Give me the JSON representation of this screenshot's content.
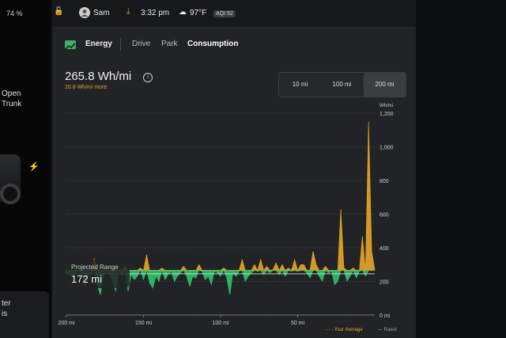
{
  "left_panel": {
    "battery": "74 %",
    "trunk_line1": "Open",
    "trunk_line2": "Trunk",
    "bottom_text": "ter\nis"
  },
  "status_bar": {
    "user": "Sam",
    "time": "3:32 pm",
    "temperature": "97°F",
    "aqi": "AQI 52"
  },
  "tabs": {
    "energy": "Energy",
    "drive": "Drive",
    "park": "Park",
    "consumption": "Consumption"
  },
  "summary": {
    "value": "265.8 Wh/mi",
    "delta": "20.8 Wh/mi more",
    "delta_suffix": "than Rated"
  },
  "range_options": [
    "10 mi",
    "100 mi",
    "200 mi"
  ],
  "selected_range": "200 mi",
  "projected": {
    "label": "Projected Range",
    "value": "172 mi"
  },
  "legend": {
    "average": "Your Average",
    "rated": "Rated"
  },
  "colors": {
    "above": "#e8a528",
    "below": "#2fc36b",
    "accent": "#3fae6a"
  },
  "chart_data": {
    "type": "area",
    "ylabel": "Wh/mi",
    "ylim": [
      0,
      1200
    ],
    "yticks": [
      "1,200",
      "1,000",
      "800",
      "600",
      "400",
      "200",
      "0 mi"
    ],
    "xticks": [
      "200 mi",
      "150 mi",
      "100 mi",
      "50 mi"
    ],
    "x_range": [
      200,
      0
    ],
    "average": 265.8,
    "rated": 245,
    "series": [
      {
        "x": [
          200,
          198,
          196,
          194,
          192,
          190,
          188,
          186,
          184,
          182,
          180,
          178,
          176,
          174,
          172,
          170,
          168,
          166,
          164,
          162,
          160,
          158,
          156,
          154,
          152,
          150,
          148,
          146,
          144,
          142,
          140,
          138,
          136,
          134,
          132,
          130,
          128,
          126,
          124,
          122,
          120,
          118,
          116,
          114,
          112,
          110,
          108,
          106,
          104,
          102,
          100,
          98,
          96,
          94,
          92,
          90,
          88,
          86,
          84,
          82,
          80,
          78,
          76,
          74,
          72,
          70,
          68,
          66,
          64,
          62,
          60,
          58,
          56,
          54,
          52,
          50,
          48,
          46,
          44,
          42,
          40,
          38,
          36,
          34,
          32,
          30,
          28,
          26,
          24,
          22,
          20,
          18,
          16,
          14,
          12,
          10,
          8,
          6,
          4,
          2,
          0
        ],
        "values": [
          250,
          240,
          230,
          255,
          260,
          250,
          170,
          230,
          250,
          335,
          180,
          120,
          230,
          260,
          240,
          200,
          140,
          260,
          230,
          290,
          140,
          240,
          210,
          230,
          280,
          210,
          360,
          190,
          160,
          230,
          200,
          280,
          210,
          240,
          260,
          200,
          230,
          250,
          290,
          230,
          170,
          230,
          220,
          300,
          260,
          210,
          230,
          180,
          260,
          250,
          230,
          280,
          220,
          120,
          250,
          230,
          260,
          330,
          200,
          230,
          250,
          300,
          260,
          330,
          240,
          290,
          250,
          270,
          310,
          240,
          300,
          230,
          280,
          260,
          330,
          260,
          300,
          300,
          250,
          220,
          380,
          300,
          230,
          200,
          290,
          250,
          260,
          180,
          200,
          630,
          280,
          200,
          230,
          280,
          220,
          260,
          470,
          230,
          1150,
          380,
          270
        ]
      }
    ]
  }
}
